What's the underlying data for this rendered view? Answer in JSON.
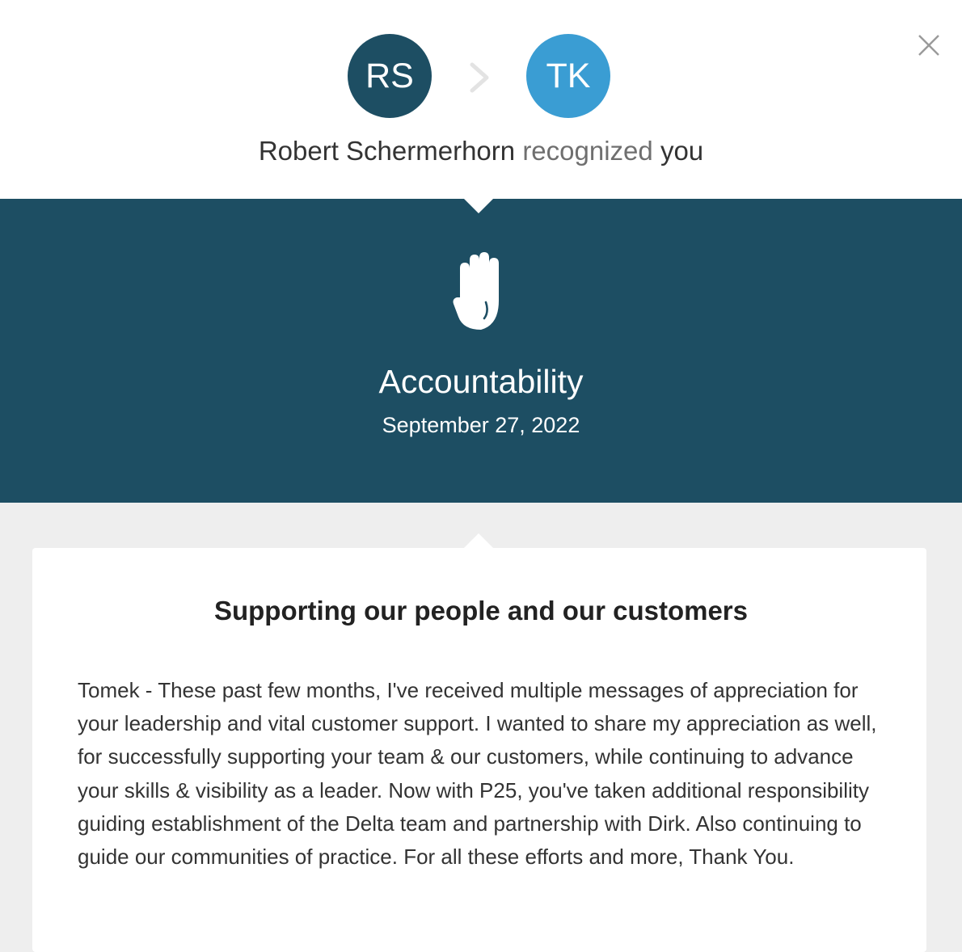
{
  "header": {
    "sender_initials": "RS",
    "recipient_initials": "TK",
    "sender_name": "Robert Schermerhorn",
    "verb": "recognized",
    "recipient": "you",
    "close_icon": "close-icon",
    "arrow_icon": "chevron-right-icon"
  },
  "banner": {
    "icon": "raised-hand-icon",
    "value": "Accountability",
    "date": "September 27, 2022"
  },
  "card": {
    "title": "Supporting our people and our customers",
    "message": "Tomek - These past few months, I've received multiple messages of appreciation for your leadership and vital customer support. I wanted to share my appreciation as well, for successfully supporting your team & our customers, while continuing to advance your skills & visibility as a leader. Now with P25, you've taken additional responsibility guiding establishment of the Delta team and partnership with Dirk. Also continuing to guide our communities of practice. For all these efforts and more, Thank You."
  },
  "colors": {
    "banner": "#1d4e63",
    "sender_avatar": "#1d4e63",
    "recipient_avatar": "#3a9dd3",
    "page_background": "#eeeeee"
  }
}
